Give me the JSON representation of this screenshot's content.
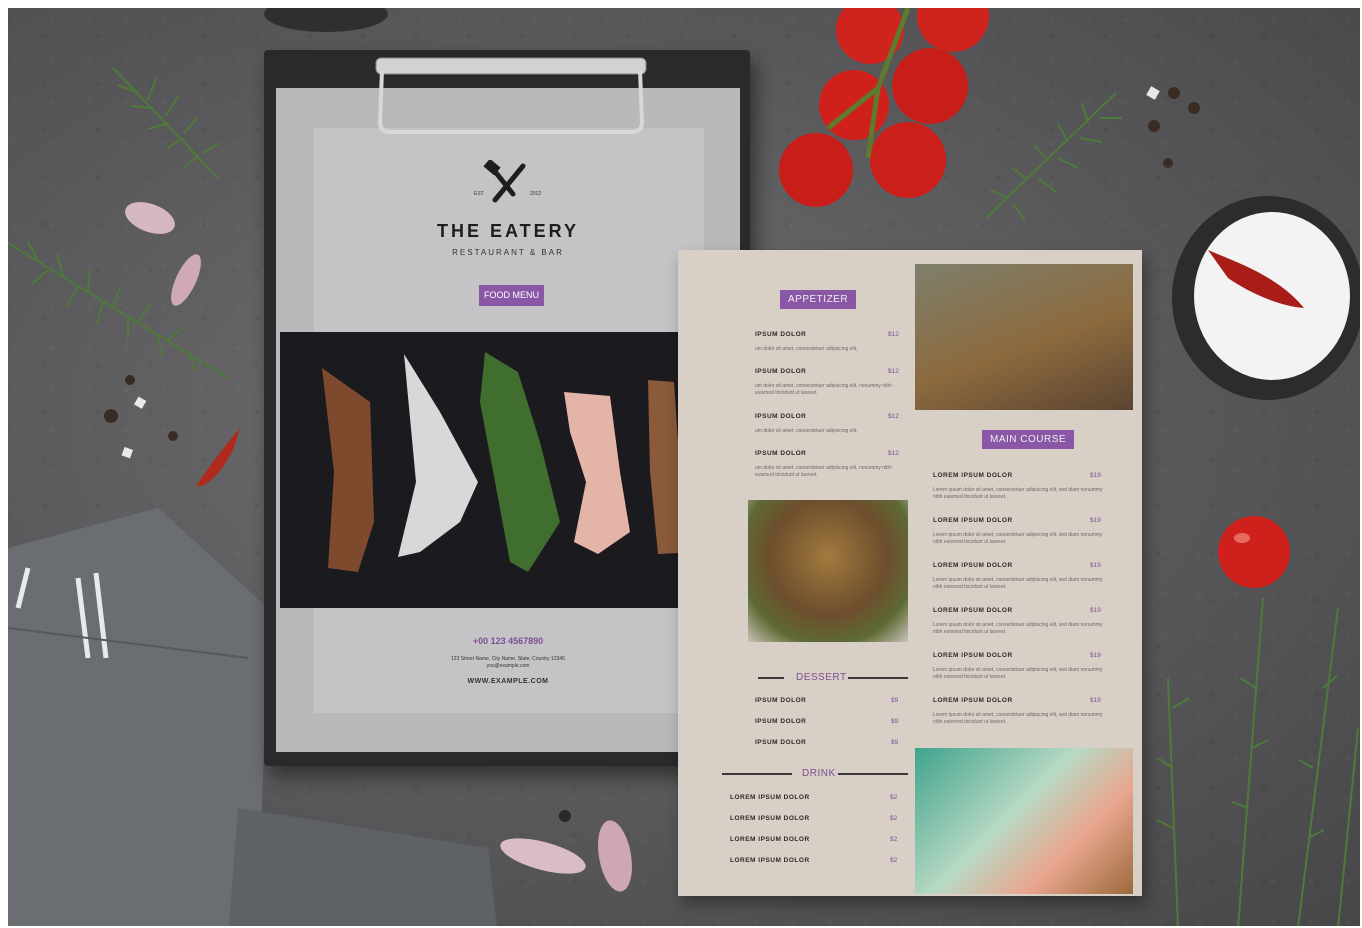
{
  "cover": {
    "est": "EST",
    "year": "2012",
    "title": "THE EATERY",
    "subtitle": "RESTAURANT & BAR",
    "button": "FOOD MENU",
    "phone": "+00 123 4567890",
    "address": "123 Street Name, City Name, State, Country 12345",
    "email": "you@example.com",
    "website": "WWW.EXAMPLE.COM"
  },
  "menu": {
    "appetizer": {
      "heading": "APPETIZER",
      "items": [
        {
          "name": "IPSUM DOLOR",
          "price": "$12",
          "desc": "um dolor sit amet, consectetuer adipiscing elit,"
        },
        {
          "name": "IPSUM DOLOR",
          "price": "$12",
          "desc": "um dolor sit amet, consectetuer adipiscing elit, nonummy nibh euismod tincidunt ut laoreet."
        },
        {
          "name": "IPSUM DOLOR",
          "price": "$12",
          "desc": "um dolor sit amet, consectetuer adipiscing elit,"
        },
        {
          "name": "IPSUM DOLOR",
          "price": "$12",
          "desc": "um dolor sit amet, consectetuer adipiscing elit, nonummy nibh euismod tincidunt ut laoreet."
        }
      ]
    },
    "main": {
      "heading": "MAIN COURSE",
      "items": [
        {
          "name": "LOREM IPSUM DOLOR",
          "price": "$19",
          "desc": "Lorem ipsum dolor sit amet, consectetuer adipiscing elit, sed diam nonummy nibh euismod tincidunt ut laoreet."
        },
        {
          "name": "LOREM IPSUM DOLOR",
          "price": "$19",
          "desc": "Lorem ipsum dolor sit amet, consectetuer adipiscing elit, sed diam nonummy nibh euismod tincidunt ut laoreet."
        },
        {
          "name": "LOREM IPSUM DOLOR",
          "price": "$19",
          "desc": "Lorem ipsum dolor sit amet, consectetuer adipiscing elit, sed diam nonummy nibh euismod tincidunt ut laoreet."
        },
        {
          "name": "LOREM IPSUM DOLOR",
          "price": "$19",
          "desc": "Lorem ipsum dolor sit amet, consectetuer adipiscing elit, sed diam nonummy nibh euismod tincidunt ut laoreet."
        },
        {
          "name": "LOREM IPSUM DOLOR",
          "price": "$19",
          "desc": "Lorem ipsum dolor sit amet, consectetuer adipiscing elit, sed diam nonummy nibh euismod tincidunt ut laoreet."
        },
        {
          "name": "LOREM IPSUM DOLOR",
          "price": "$19",
          "desc": "Lorem ipsum dolor sit amet, consectetuer adipiscing elit, sed diam nonummy nibh euismod tincidunt ut laoreet."
        }
      ]
    },
    "dessert": {
      "heading": "DESSERT",
      "items": [
        {
          "name": "IPSUM DOLOR",
          "price": "$9"
        },
        {
          "name": "IPSUM DOLOR",
          "price": "$9"
        },
        {
          "name": "IPSUM DOLOR",
          "price": "$9"
        }
      ]
    },
    "drink": {
      "heading": "DRINK",
      "items": [
        {
          "name": "LOREM IPSUM DOLOR",
          "price": "$2"
        },
        {
          "name": "LOREM IPSUM DOLOR",
          "price": "$2"
        },
        {
          "name": "LOREM IPSUM DOLOR",
          "price": "$2"
        },
        {
          "name": "LOREM IPSUM DOLOR",
          "price": "$2"
        }
      ]
    }
  },
  "colors": {
    "accent": "#8a57a6",
    "table": "#5a5a5c",
    "menu_paper": "#d8cfc6"
  }
}
